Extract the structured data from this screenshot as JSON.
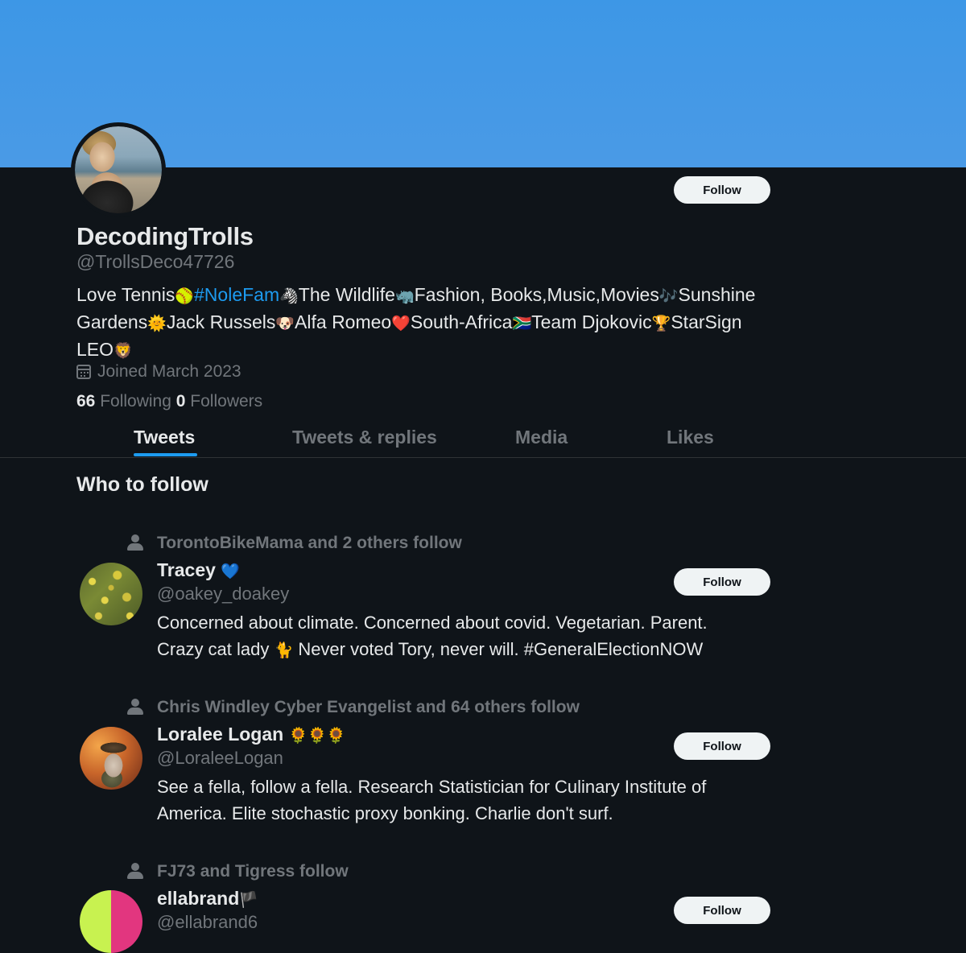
{
  "theme": {
    "accent": "#1d9bf0",
    "background": "#0f1419",
    "banner": "#4a9ae6"
  },
  "profile": {
    "display_name": "DecodingTrolls",
    "handle": "@TrollsDeco47726",
    "follow_label": "Follow",
    "bio": {
      "t1": "Love Tennis",
      "e1": "🥎",
      "hashtag": "#NoleFam",
      "e2": "🦓",
      "t2": "The Wildlife",
      "e3": "🦏",
      "t3": "Fashion, Books,Music,Movies",
      "e4": "🎶",
      "t4": "Sunshine Gardens",
      "e5": "🌞",
      "t5": "Jack Russels",
      "e6": "🐶",
      "t6": "Alfa Romeo",
      "e7": "❤️",
      "t7": "South-Africa",
      "e8": "🇿🇦",
      "t8": "Team Djokovic",
      "e9": "🏆",
      "t9": "StarSign LEO",
      "e10": "🦁"
    },
    "joined": "Joined March 2023",
    "following_count": "66",
    "following_label": "Following",
    "followers_count": "0",
    "followers_label": "Followers"
  },
  "tabs": [
    "Tweets",
    "Tweets & replies",
    "Media",
    "Likes"
  ],
  "who_to_follow": {
    "title": "Who to follow",
    "items": [
      {
        "social": "TorontoBikeMama and 2 others follow",
        "name": "Tracey",
        "name_emoji": "💙",
        "handle": "@oakey_doakey",
        "bio_line1": "Concerned about climate. Concerned about covid. Vegetarian. Parent.",
        "bio_line2_a": "Crazy cat lady",
        "bio_emoji": "🐈",
        "bio_line2_b": "Never voted Tory, never will. #GeneralElectionNOW",
        "follow_label": "Follow"
      },
      {
        "social": "Chris Windley Cyber Evangelist and 64 others follow",
        "name": "Loralee Logan",
        "name_emoji": "🌻🌻🌻",
        "handle": "@LoraleeLogan",
        "bio_line1": "See a fella, follow a fella. Research Statistician for Culinary Institute of",
        "bio_line2_a": "America. Elite stochastic proxy bonking. Charlie don't surf.",
        "follow_label": "Follow"
      },
      {
        "social": "FJ73 and Tigress follow",
        "name": "ellabrand",
        "name_emoji": "🏴",
        "handle": "@ellabrand6",
        "follow_label": "Follow"
      }
    ]
  }
}
